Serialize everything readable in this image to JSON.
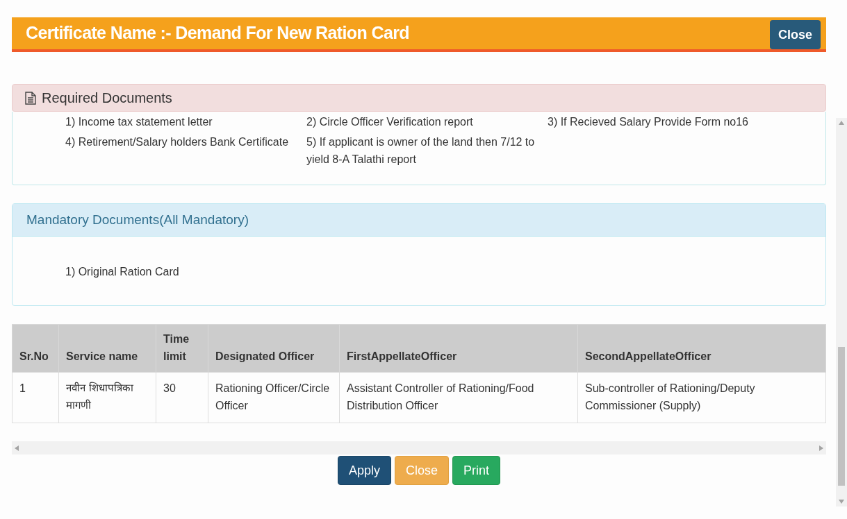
{
  "modal": {
    "title": "Certificate Name :- Demand For New Ration Card",
    "close_label": "Close"
  },
  "required_documents": {
    "title": "Required Documents",
    "items": [
      "1) Income tax statement letter",
      "2) Circle Officer Verification report",
      "3) If Recieved Salary Provide Form no16",
      "4) Retirement/Salary holders Bank Certificate",
      "5) If applicant is owner of the land then 7/12 to yield 8-A Talathi report"
    ]
  },
  "mandatory_documents": {
    "title": "Mandatory Documents(All Mandatory)",
    "items": [
      "1) Original Ration Card"
    ]
  },
  "table": {
    "columns": [
      "Sr.No",
      "Service name",
      "Time limit",
      "Designated Officer",
      "FirstAppellateOfficer",
      "SecondAppellateOfficer"
    ],
    "rows": [
      [
        "1",
        "नवीन शिधापत्रिका मागणी",
        "30",
        "Rationing Officer/Circle Officer",
        "Assistant Controller of Rationing/Food Distribution Officer",
        "Sub-controller of Rationing/Deputy Commissioner (Supply)"
      ]
    ]
  },
  "buttons": [
    {
      "label": "Apply",
      "kind": "primary"
    },
    {
      "label": "Close",
      "kind": "warning"
    },
    {
      "label": "Print",
      "kind": "success"
    }
  ]
}
